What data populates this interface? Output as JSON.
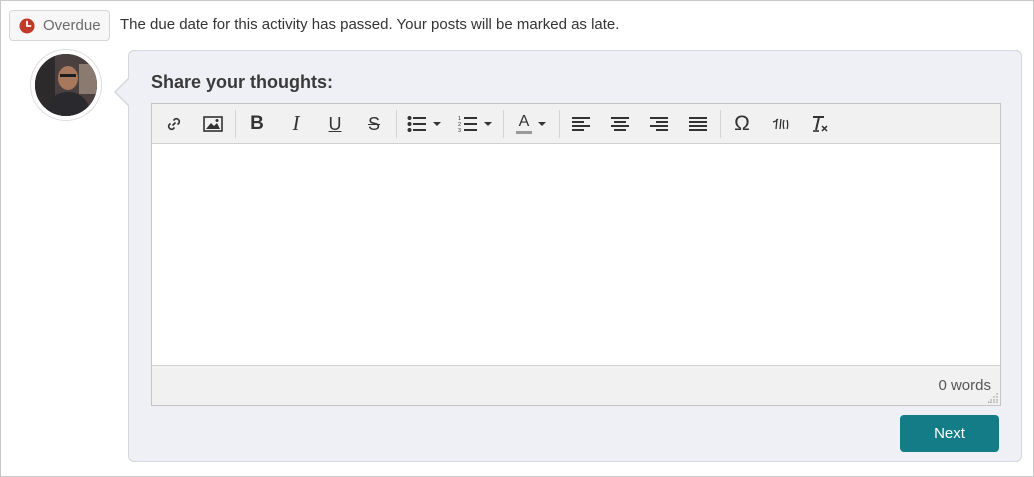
{
  "overdue": {
    "badge_label": "Overdue",
    "message": "The due date for this activity has passed. Your posts will be marked as late."
  },
  "composer": {
    "title": "Share your thoughts:",
    "word_count": "0 words",
    "next_label": "Next"
  },
  "toolbar": {
    "buttons": [
      {
        "name": "link-icon"
      },
      {
        "name": "image-icon"
      },
      {
        "name": "bold-icon",
        "glyph": "B"
      },
      {
        "name": "italic-icon",
        "glyph": "I"
      },
      {
        "name": "underline-icon",
        "glyph": "U"
      },
      {
        "name": "strikethrough-icon",
        "glyph": "S"
      },
      {
        "name": "bullet-list-icon"
      },
      {
        "name": "numbered-list-icon"
      },
      {
        "name": "text-color-icon",
        "glyph": "A"
      },
      {
        "name": "align-left-icon"
      },
      {
        "name": "align-center-icon"
      },
      {
        "name": "align-right-icon"
      },
      {
        "name": "align-justify-icon"
      },
      {
        "name": "special-character-icon",
        "glyph": "Ω"
      },
      {
        "name": "math-formula-icon"
      },
      {
        "name": "clear-formatting-icon"
      }
    ]
  },
  "colors": {
    "accent": "#137c87",
    "overdue_icon": "#c0392b",
    "card_bg": "#eef0f5"
  }
}
